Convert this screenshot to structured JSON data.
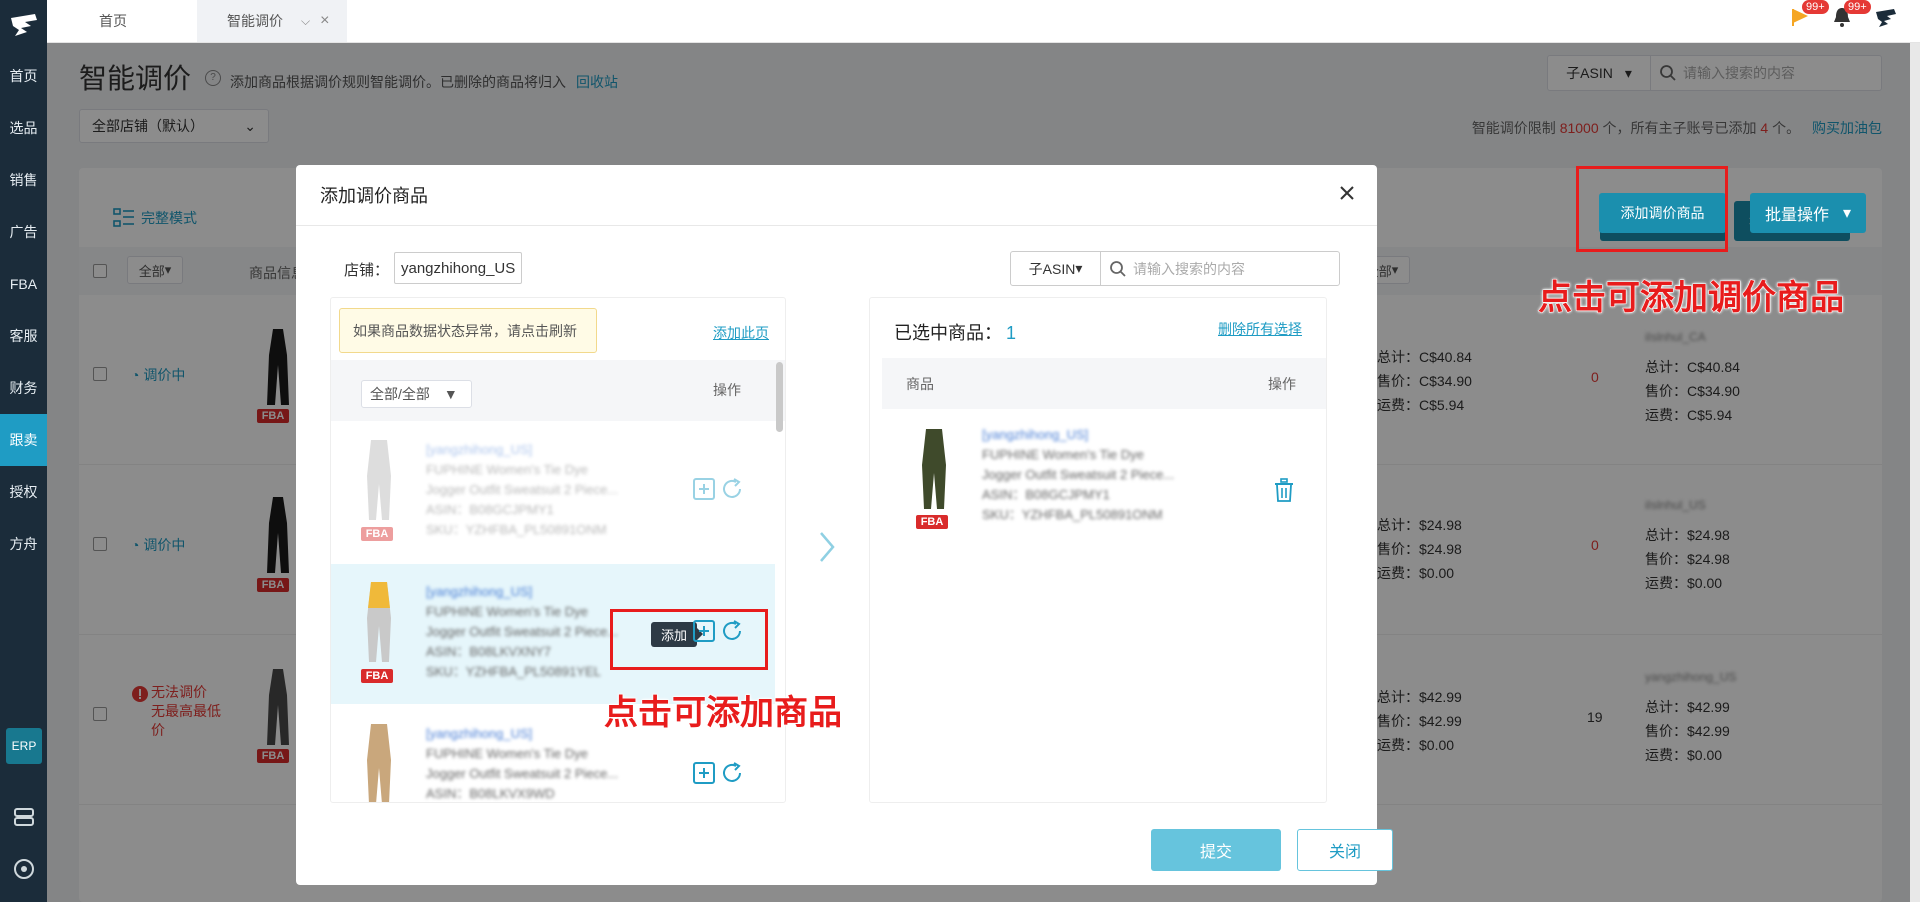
{
  "sidebar": {
    "items": [
      {
        "label": "首页"
      },
      {
        "label": "选品"
      },
      {
        "label": "销售"
      },
      {
        "label": "广告"
      },
      {
        "label": "FBA"
      },
      {
        "label": "客服"
      },
      {
        "label": "财务"
      },
      {
        "label": "跟卖"
      },
      {
        "label": "授权"
      },
      {
        "label": "方舟"
      }
    ],
    "active_index": 7,
    "erp_label": "ERP"
  },
  "tabs": {
    "home": "首页",
    "active": "智能调价"
  },
  "topbar": {
    "flag_badge": "99+",
    "bell_badge": "99+"
  },
  "page": {
    "title": "智能调价",
    "description": "添加商品根据调价规则智能调价。已删除的商品将归入",
    "recycle_link": "回收站",
    "store_select": "全部店铺（默认）",
    "search_type": "子ASIN",
    "search_placeholder": "请输入搜索的内容",
    "limit_prefix": "智能调价限制",
    "limit_value": "81000",
    "limit_mid": "个，所有主子账号已添加",
    "limit_used": "4",
    "limit_suffix": "个。",
    "buy_link": "购买加油包",
    "full_mode": "完整模式",
    "add_button": "添加调价商品",
    "batch_button": "批量操作",
    "filter_all": "全部",
    "col_product": "商品信息",
    "rows": [
      {
        "status": "调价中",
        "total": "总计：C$40.84",
        "price": "售价：C$34.90",
        "ship": "运费：C$5.94",
        "num": "0",
        "r_total": "总计：C$40.84",
        "r_price": "售价：C$34.90",
        "r_ship": "运费：C$5.94",
        "store": "iIslnhul_CA"
      },
      {
        "status": "调价中",
        "total": "总计：$24.98",
        "price": "售价：$24.98",
        "ship": "运费：$0.00",
        "num": "0",
        "r_total": "总计：$24.98",
        "r_price": "售价：$24.98",
        "r_ship": "运费：$0.00",
        "store": "iIslnhul_US"
      },
      {
        "status": "无法调价 无最高最低价",
        "total": "总计：$42.99",
        "price": "售价：$42.99",
        "ship": "运费：$0.00",
        "num": "19",
        "r_total": "总计：$42.99",
        "r_price": "售价：$42.99",
        "r_ship": "运费：$0.00",
        "store": "yangzhihong_US"
      }
    ]
  },
  "modal": {
    "title": "添加调价商品",
    "shop_label": "店铺：",
    "shop_value": "yangzhihong_US",
    "search_type": "子ASIN",
    "search_placeholder": "请输入搜索的内容",
    "warning": "如果商品数据状态异常，请点击刷新",
    "add_page": "添加此页",
    "filter": "全部/全部",
    "op_label": "操作",
    "tooltip": "添加",
    "items": [
      {
        "store": "[yangzhihong_US]",
        "title1": "FUPHINE Women's Tie Dye",
        "title2": "Jogger Outfit Sweatsuit 2 Piece...",
        "asin": "ASIN：B08GCJPMY1",
        "sku": "SKU：YZHFBA_PL50891ONM"
      },
      {
        "store": "[yangzhihong_US]",
        "title1": "FUPHINE Women's Tie Dye",
        "title2": "Jogger Outfit Sweatsuit 2 Piece...",
        "asin": "ASIN：B08LKVXNY7",
        "sku": "SKU：YZHFBA_PL50891YEL"
      },
      {
        "store": "[yangzhihong_US]",
        "title1": "FUPHINE Women's Tie Dye",
        "title2": "Jogger Outfit Sweatsuit 2 Piece...",
        "asin": "ASIN：B08LKVX9WD",
        "sku": ""
      }
    ],
    "selected_label": "已选中商品：",
    "selected_count": "1",
    "clear_all": "删除所有选择",
    "col_product": "商品",
    "col_op": "操作",
    "selected_item": {
      "store": "[yangzhihong_US]",
      "title1": "FUPHINE Women's Tie Dye",
      "title2": "Jogger Outfit Sweatsuit 2 Piece...",
      "asin": "ASIN：B08GCJPMY1",
      "sku": "SKU：YZHFBA_PL50891ONM"
    },
    "submit": "提交",
    "close": "关闭",
    "fba": "FBA"
  },
  "annotations": {
    "top": "点击可添加调价商品",
    "mid": "点击可添加商品"
  },
  "colors": {
    "primary": "#1b8fae",
    "accent": "#1f9cc4",
    "sidebar": "#1b2c3a",
    "annotation": "#e81c1c"
  }
}
